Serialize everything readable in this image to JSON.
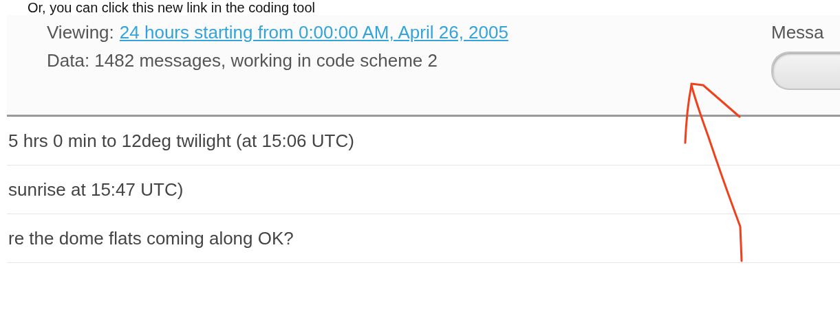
{
  "caption": "Or, you can click this new link in the coding tool",
  "header": {
    "viewing_label": "Viewing:",
    "viewing_link": "24 hours starting from 0:00:00 AM, April 26, 2005",
    "data_summary": "Data: 1482 messages, working in code scheme 2",
    "side_label": "Messa"
  },
  "messages": [
    {
      "text": "5 hrs 0 min to 12deg twilight (at 15:06 UTC)"
    },
    {
      "text": "sunrise at 15:47 UTC)"
    },
    {
      "text": "re the dome flats coming along OK?"
    }
  ]
}
